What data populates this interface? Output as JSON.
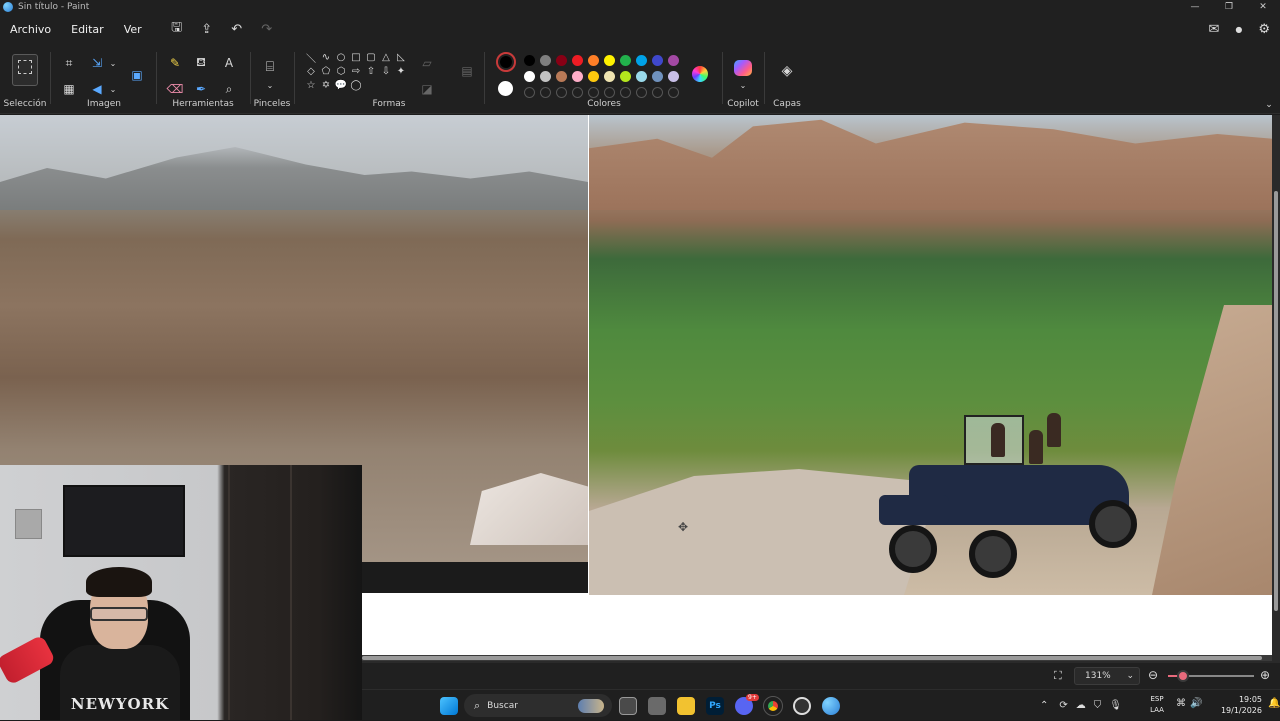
{
  "window": {
    "title": "Sin título - Paint",
    "controls": [
      "—",
      "❐",
      "✕"
    ]
  },
  "menu": {
    "items": [
      "Archivo",
      "Editar",
      "Ver"
    ]
  },
  "quick_access": {
    "save_icon": "save-icon",
    "share_icon": "share-icon",
    "undo_icon": "undo-icon",
    "redo_icon": "redo-icon"
  },
  "ribbon": {
    "groups": {
      "seleccion": "Selección",
      "imagen": "Imagen",
      "herramientas": "Herramientas",
      "pinceles": "Pinceles",
      "formas": "Formas",
      "colores": "Colores",
      "copilot": "Copilot",
      "capas": "Capas"
    },
    "shape_glyphs": [
      "＼",
      "∿",
      "○",
      "□",
      "▢",
      "△",
      "◺",
      "◇",
      "⬠",
      "⬡",
      "⇨",
      "⇧",
      "⇩",
      "✦",
      "☆",
      "✡",
      "💬",
      "◯"
    ],
    "palette_row1": [
      "#000000",
      "#7f7f7f",
      "#880015",
      "#ed1c24",
      "#ff7f27",
      "#fff200",
      "#22b14c",
      "#00a2e8",
      "#3f48cc",
      "#a349a4"
    ],
    "palette_row2": [
      "#ffffff",
      "#c3c3c3",
      "#b97a57",
      "#ffaec9",
      "#ffc90e",
      "#efe4b0",
      "#b5e61d",
      "#99d9ea",
      "#7092be",
      "#c8bfe7"
    ],
    "primary_color": "#000000",
    "secondary_color": "#ffffff"
  },
  "status": {
    "zoom": "131%",
    "zoom_percent": 131,
    "zoom_fraction": 0.18
  },
  "webcam": {
    "hoodie_text": "NEWYORK"
  },
  "taskbar": {
    "search_placeholder": "Buscar",
    "ps_label": "Ps",
    "discord_badge": "9+",
    "language_line1": "ESP",
    "language_line2": "LAA",
    "time": "19:05",
    "date": "19/1/2026"
  }
}
